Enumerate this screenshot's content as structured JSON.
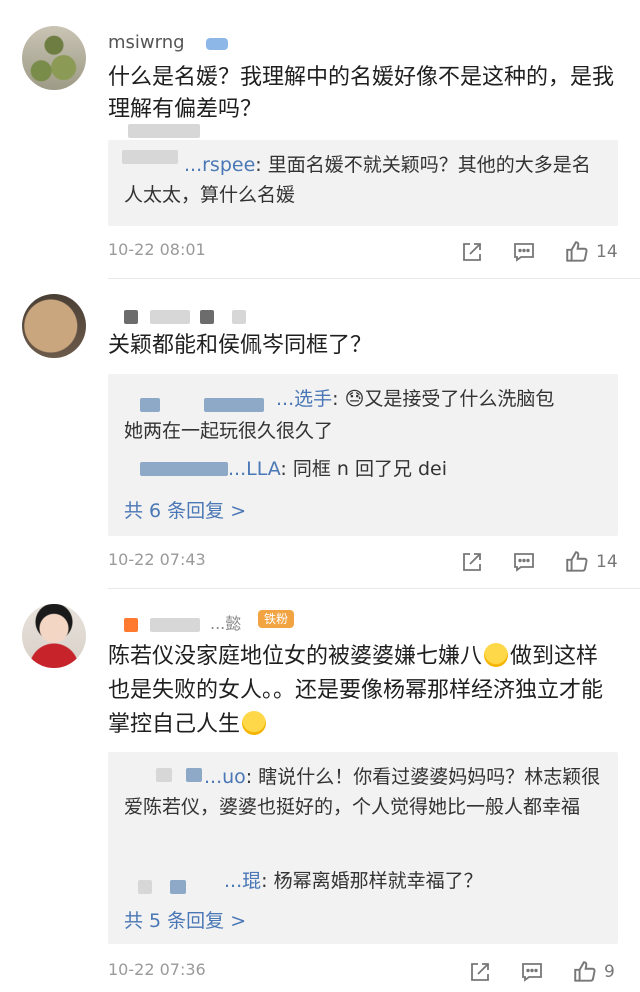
{
  "comments": [
    {
      "username": "msiwrng",
      "text": "什么是名媛？我理解中的名媛好像不是这种的，是我理解有偏差吗？",
      "replies": [
        {
          "name": "...rspee",
          "text": ": 里面名媛不就关颖吗？其他的大多是名人太太，算什么名媛"
        }
      ],
      "more": "",
      "timestamp": "10-22 08:01",
      "likes": "14"
    },
    {
      "username": "",
      "text": "关颖都能和侯佩岑同框了？",
      "replies": [
        {
          "name": "...选手",
          "text": ": 😓又是接受了什么洗脑包",
          "text2": "她两在一起玩很久很久了"
        },
        {
          "name": "...LLA",
          "text": ": 同框 n 回了兄 dei"
        }
      ],
      "more": "共 6 条回复 >",
      "timestamp": "10-22 07:43",
      "likes": "14"
    },
    {
      "username": "...懿",
      "badge": "铁粉",
      "text_a": "陈若仪没家庭地位女的被婆婆嫌七嫌八",
      "text_b": "做到这样也是失败的女人。。还是要像杨幂那样经济独立才能掌控自己人生",
      "replies": [
        {
          "name": "...uo",
          "text": ": 瞎说什么！你看过婆婆妈妈吗？林志颖很爱陈若仪，婆婆也挺好的，个人觉得她比一般人都幸福"
        },
        {
          "name": "...琨",
          "text": ": 杨幂离婚那样就幸福了？"
        }
      ],
      "more": "共 5 条回复 >",
      "timestamp": "10-22 07:36",
      "likes": "9"
    }
  ],
  "icons": {
    "share": "share-icon",
    "comment": "comment-icon",
    "like": "thumbs-up-icon"
  },
  "colors": {
    "link": "#4a77b5",
    "reply_bg": "#f2f2f2",
    "timestamp": "#9a9a9a",
    "badge": "#f2a443"
  }
}
